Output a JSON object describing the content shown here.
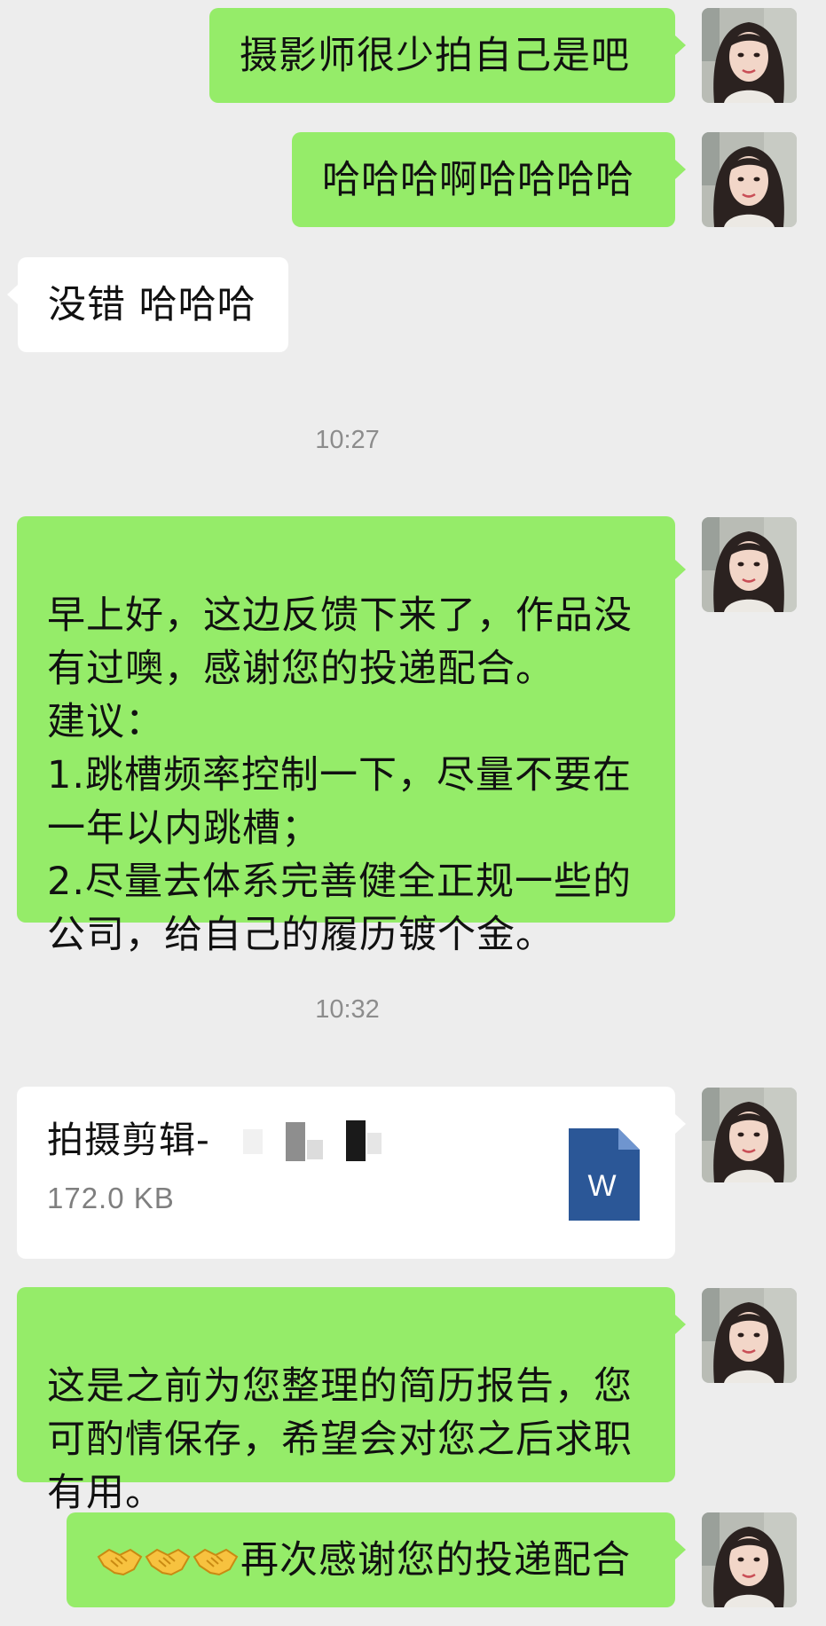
{
  "messages": [
    {
      "text": "摄影师很少拍自己是吧"
    },
    {
      "text": "哈哈哈啊哈哈哈哈"
    },
    {
      "text": "没错 哈哈哈"
    },
    {
      "text": "早上好，这边反馈下来了，作品没\n有过噢，感谢您的投递配合。\n建议：\n1.跳槽频率控制一下，尽量不要在\n一年以内跳槽；\n2.尽量去体系完善健全正规一些的\n公司，给自己的履历镀个金。"
    },
    {
      "text": "这是之前为您整理的简历报告，您\n可酌情保存，希望会对您之后求职\n有用。"
    },
    {
      "text": "再次感谢您的投递配合",
      "emoji": "handshake"
    }
  ],
  "timestamps": [
    "10:27",
    "10:32"
  ],
  "file": {
    "name": "拍摄剪辑-",
    "size": "172.0 KB",
    "icon_label": "W",
    "icon_color": "#2b5797"
  },
  "colors": {
    "background": "#ededed",
    "outgoing_bubble": "#95ec69",
    "incoming_bubble": "#ffffff"
  }
}
